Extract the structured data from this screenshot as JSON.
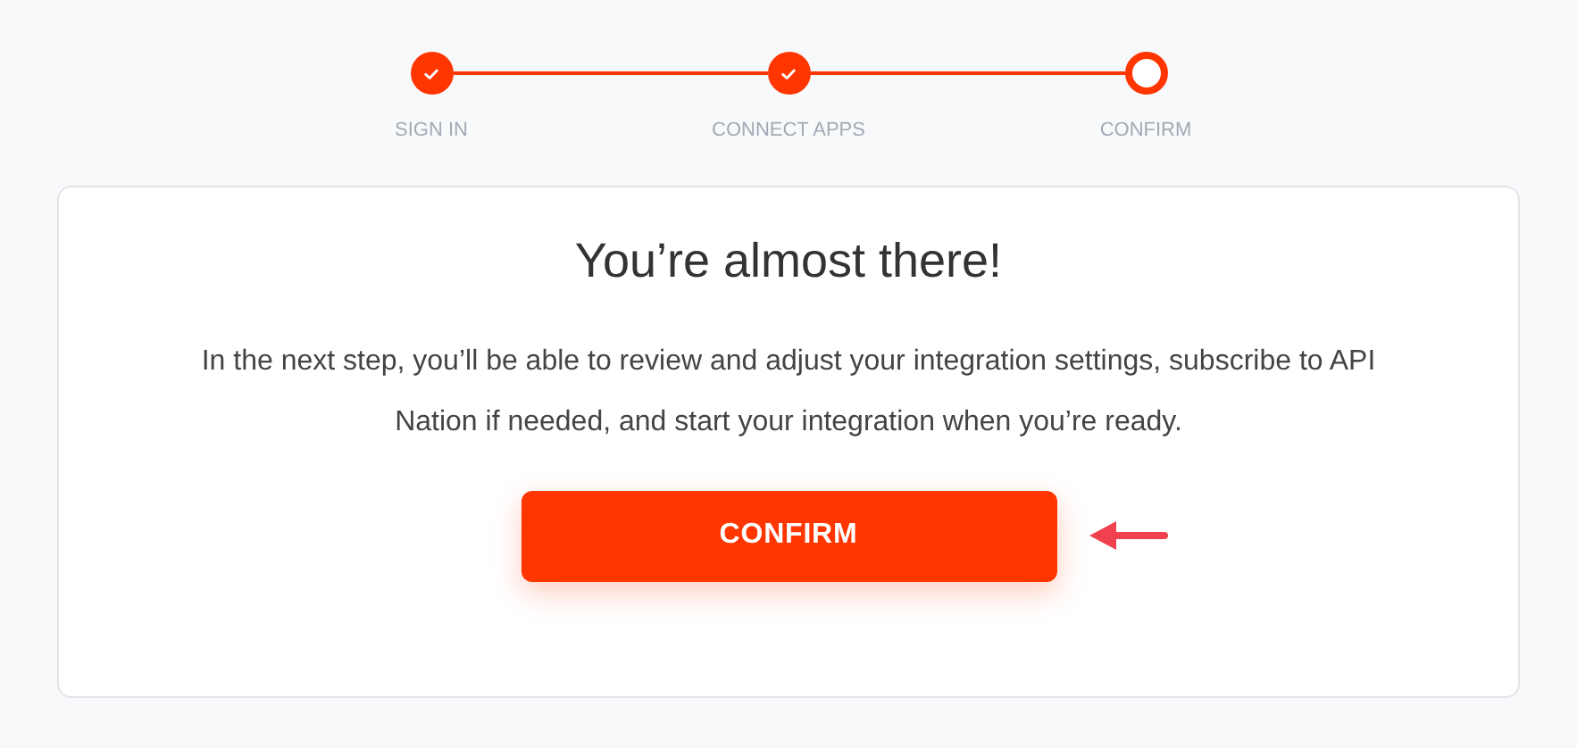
{
  "steps": [
    {
      "label": "SIGN IN",
      "done": true
    },
    {
      "label": "CONNECT APPS",
      "done": true
    },
    {
      "label": "CONFIRM",
      "done": false
    }
  ],
  "card": {
    "title": "You’re almost there!",
    "text": "In the next step, you’ll be able to review and adjust your integration settings, subscribe to API Nation if needed, and start your integration when you’re ready.",
    "button": "CONFIRM"
  }
}
